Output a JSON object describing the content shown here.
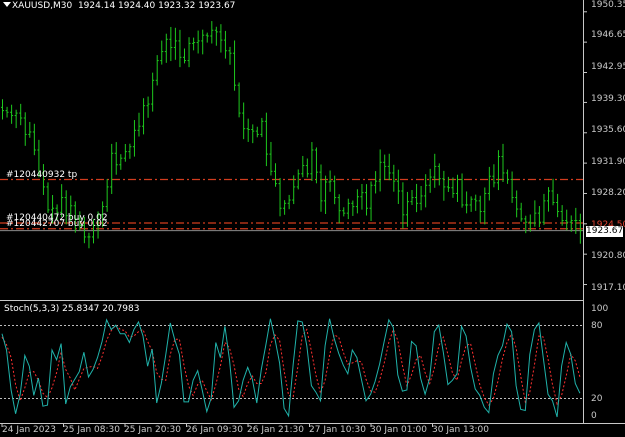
{
  "chart_header": {
    "symbol_tf": "XAUUSD,M30",
    "ohlc": "1924.14 1924.40 1923.32 1923.67"
  },
  "price_axis": [
    "1950.35",
    "1946.65",
    "1942.95",
    "1939.30",
    "1935.60",
    "1931.90",
    "1928.20",
    "1924.50",
    "1920.80",
    "1917.10"
  ],
  "current_price": "1923.67",
  "orders": [
    {
      "label": "#120440932 tp",
      "color": "#d23c1e"
    },
    {
      "label": "#120440472 buy 0.02",
      "color": "#d23c1e"
    },
    {
      "label": "#120442707 buy 0.02",
      "color": "#d23c1e"
    }
  ],
  "time_axis": [
    "24 Jan 2023",
    "25 Jan 08:30",
    "25 Jan 20:30",
    "26 Jan 09:30",
    "26 Jan 21:30",
    "27 Jan 10:30",
    "30 Jan 01:00",
    "30 Jan 13:00"
  ],
  "indicator": {
    "title": "Stoch(5,3,3) 25.8347 20.7983",
    "levels": [
      "100",
      "80",
      "20",
      "0"
    ]
  },
  "colors": {
    "candle": "#1ec81e",
    "main_line": "#20b2aa",
    "signal_line": "#ff3030",
    "order_line": "#d23c1e",
    "background": "#000000"
  },
  "chart_data": {
    "type": "line",
    "series": [
      {
        "name": "XAUUSD,M30",
        "values": [
          1938.3,
          1938.1,
          1937.7,
          1938.0,
          1937.4,
          1935.4,
          1935.7,
          1933.5,
          1930.7,
          1929.0,
          1926.2,
          1926.4,
          1925.9,
          1927.7,
          1925.5,
          1926.7,
          1925.1,
          1924.3,
          1922.9,
          1922.9,
          1924.3,
          1925.6,
          1926.6,
          1929.0,
          1933.1,
          1931.7,
          1932.5,
          1933.3,
          1933.9,
          1935.9,
          1936.4,
          1938.9,
          1939.1,
          1942.0,
          1944.4,
          1945.5,
          1947.0,
          1946.0,
          1946.8,
          1944.8,
          1944.4,
          1946.5,
          1946.6,
          1946.8,
          1947.5,
          1947.4,
          1948.1,
          1947.9,
          1946.9,
          1945.6,
          1945.3,
          1941.4,
          1938.0,
          1936.1,
          1936.0,
          1935.8,
          1935.4,
          1937.0,
          1933.0,
          1930.9,
          1929.4,
          1926.4,
          1927.0,
          1927.4,
          1929.0,
          1930.6,
          1931.6,
          1930.6,
          1933.5,
          1930.8,
          1927.3,
          1929.6,
          1929.7,
          1927.7,
          1926.1,
          1925.8,
          1927.0,
          1926.6,
          1927.8,
          1928.3,
          1926.4,
          1929.2,
          1929.7,
          1932.0,
          1931.5,
          1930.7,
          1929.7,
          1928.5,
          1925.6,
          1927.2,
          1927.7,
          1927.0,
          1927.9,
          1929.2,
          1930.2,
          1931.5,
          1930.0,
          1929.0,
          1928.9,
          1928.2,
          1929.9,
          1926.8,
          1926.8,
          1927.5,
          1927.3,
          1926.0,
          1928.2,
          1930.3,
          1929.5,
          1932.7,
          1930.7,
          1929.9,
          1927.7,
          1926.3,
          1925.1,
          1924.7,
          1924.6,
          1925.8,
          1924.7,
          1927.3,
          1928.5,
          1927.1,
          1926.0,
          1924.9,
          1924.7,
          1924.9,
          1924.9,
          1923.7
        ]
      },
      {
        "name": "Stoch main",
        "values": [
          77,
          62,
          25,
          3,
          21,
          57,
          47,
          20,
          36,
          10,
          11,
          62,
          53,
          68,
          12,
          28,
          35,
          42,
          60,
          37,
          44,
          55,
          70,
          90,
          81,
          85,
          77,
          77,
          69,
          81,
          88,
          75,
          47,
          63,
          13,
          31,
          58,
          87,
          71,
          58,
          14,
          14,
          34,
          43,
          25,
          5,
          18,
          69,
          55,
          84,
          53,
          9,
          15,
          34,
          46,
          35,
          13,
          44,
          67,
          91,
          72,
          50,
          8,
          1,
          49,
          89,
          88,
          66,
          29,
          23,
          15,
          66,
          91,
          73,
          59,
          48,
          40,
          62,
          55,
          35,
          15,
          21,
          33,
          49,
          70,
          90,
          83,
          39,
          24,
          25,
          70,
          66,
          36,
          21,
          36,
          79,
          85,
          60,
          30,
          34,
          40,
          84,
          75,
          46,
          26,
          20,
          9,
          4,
          40,
          57,
          66,
          86,
          79,
          29,
          7,
          6,
          58,
          81,
          87,
          54,
          21,
          15,
          0,
          47,
          69,
          58,
          31,
          22
        ]
      },
      {
        "name": "Stoch signal",
        "values": [
          74,
          67,
          55,
          30,
          15,
          27,
          41,
          42,
          34,
          22,
          18,
          27,
          41,
          60,
          44,
          36,
          25,
          35,
          45,
          46,
          47,
          45,
          56,
          71,
          80,
          85,
          81,
          80,
          74,
          75,
          79,
          81,
          70,
          61,
          41,
          35,
          34,
          58,
          72,
          72,
          48,
          29,
          20,
          30,
          34,
          24,
          16,
          30,
          47,
          69,
          64,
          48,
          26,
          19,
          31,
          38,
          31,
          31,
          41,
          67,
          76,
          71,
          43,
          20,
          19,
          46,
          75,
          81,
          61,
          39,
          22,
          34,
          57,
          76,
          74,
          60,
          49,
          50,
          52,
          51,
          35,
          24,
          23,
          34,
          50,
          69,
          81,
          71,
          48,
          29,
          39,
          53,
          57,
          41,
          31,
          45,
          66,
          74,
          58,
          41,
          34,
          52,
          66,
          68,
          49,
          30,
          18,
          11,
          17,
          33,
          54,
          69,
          77,
          64,
          38,
          14,
          23,
          48,
          75,
          74,
          54,
          30,
          12,
          20,
          38,
          58,
          52,
          37
        ]
      }
    ],
    "ylim": [
      1915.7,
      1951.3
    ],
    "stoch_ylim": [
      0,
      100
    ],
    "order_levels": [
      1929.9,
      1924.6,
      1923.9
    ],
    "current_price_level": 1923.67,
    "grid": false
  }
}
